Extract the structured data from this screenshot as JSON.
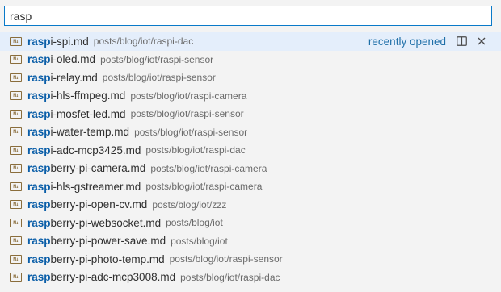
{
  "search": {
    "value": "rasp"
  },
  "icons": {
    "file_icon": "markdown-file-icon",
    "split_icon": "split-editor-icon",
    "close_icon": "close-icon"
  },
  "colors": {
    "focus_border": "#0a7ac9",
    "highlight_text": "#0a5ea8",
    "active_row_bg": "#e4eefb",
    "recent_label": "#1e6fa8"
  },
  "results": [
    {
      "match": "rasp",
      "rest": "i-spi.md",
      "path": "posts/blog/iot/raspi-dac",
      "badge": "recently opened"
    },
    {
      "match": "rasp",
      "rest": "i-oled.md",
      "path": "posts/blog/iot/raspi-sensor"
    },
    {
      "match": "rasp",
      "rest": "i-relay.md",
      "path": "posts/blog/iot/raspi-sensor"
    },
    {
      "match": "rasp",
      "rest": "i-hls-ffmpeg.md",
      "path": "posts/blog/iot/raspi-camera"
    },
    {
      "match": "rasp",
      "rest": "i-mosfet-led.md",
      "path": "posts/blog/iot/raspi-sensor"
    },
    {
      "match": "rasp",
      "rest": "i-water-temp.md",
      "path": "posts/blog/iot/raspi-sensor"
    },
    {
      "match": "rasp",
      "rest": "i-adc-mcp3425.md",
      "path": "posts/blog/iot/raspi-dac"
    },
    {
      "match": "rasp",
      "rest": "berry-pi-camera.md",
      "path": "posts/blog/iot/raspi-camera"
    },
    {
      "match": "rasp",
      "rest": "i-hls-gstreamer.md",
      "path": "posts/blog/iot/raspi-camera"
    },
    {
      "match": "rasp",
      "rest": "berry-pi-open-cv.md",
      "path": "posts/blog/iot/zzz"
    },
    {
      "match": "rasp",
      "rest": "berry-pi-websocket.md",
      "path": "posts/blog/iot"
    },
    {
      "match": "rasp",
      "rest": "berry-pi-power-save.md",
      "path": "posts/blog/iot"
    },
    {
      "match": "rasp",
      "rest": "berry-pi-photo-temp.md",
      "path": "posts/blog/iot/raspi-sensor"
    },
    {
      "match": "rasp",
      "rest": "berry-pi-adc-mcp3008.md",
      "path": "posts/blog/iot/raspi-dac"
    }
  ]
}
